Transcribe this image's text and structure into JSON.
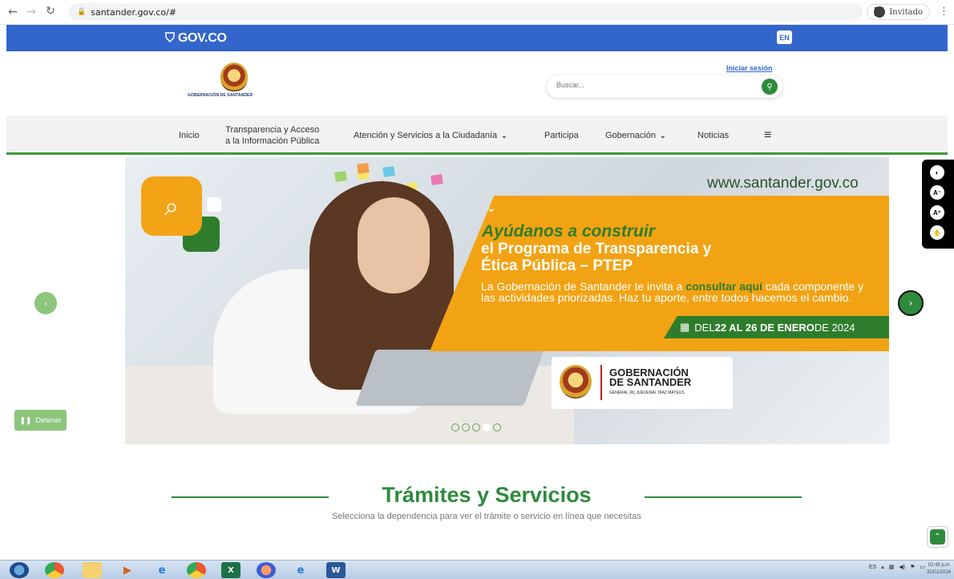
{
  "browser": {
    "url": "santander.gov.co/#",
    "profile_label": "Invitado"
  },
  "govbar": {
    "logo_text": "GOV.CO",
    "lang_button": "EN"
  },
  "header": {
    "logo_text": "GOBERNACIÓN DE SANTANDER",
    "login_link": "Iniciar sesión",
    "search_placeholder": "Buscar..."
  },
  "nav": {
    "items": [
      {
        "label": "Inicio"
      },
      {
        "label": "Transparencia y Acceso",
        "label2": "a la Información Pública"
      },
      {
        "label": "Atención y Servicios a la Ciudadanía"
      },
      {
        "label": "Participa"
      },
      {
        "label": "Gobernación"
      },
      {
        "label": "Noticias"
      }
    ]
  },
  "hero": {
    "url_text": "www.santander.gov.co",
    "headline1": "Ayúdanos a construir",
    "headline2": "el Programa de Transparencia y",
    "headline3": "Ética Pública – PTEP",
    "body_pre": "La Gobernación de Santander te invita a ",
    "body_bold": "consultar aquí",
    "body_post": " cada componente y las actividades priorizadas. Haz tu aporte, entre todos hacemos el cambio.",
    "date_pre": "DEL ",
    "date_bold": "22 AL 26 DE ENERO",
    "date_post": " DE 2024",
    "card_title1": "GOBERNACIÓN",
    "card_title2": "DE SANTANDER",
    "card_sub": "GENERAL (R) JUEVENAL DÍAZ MATEUS",
    "active_slide": 4,
    "slide_count": 5
  },
  "carousel": {
    "stop_label": "Detener"
  },
  "section": {
    "title": "Trámites y Servicios",
    "subtitle": "Selecciona la dependencia para ver el trámite o servicio en línea que necesitas"
  },
  "taskbar": {
    "lang": "ES",
    "time": "02:45 p.m.",
    "date": "31/01/2024"
  },
  "colors": {
    "gov_blue": "#3366cc",
    "green": "#2e8b3c",
    "orange": "#f2a314"
  }
}
